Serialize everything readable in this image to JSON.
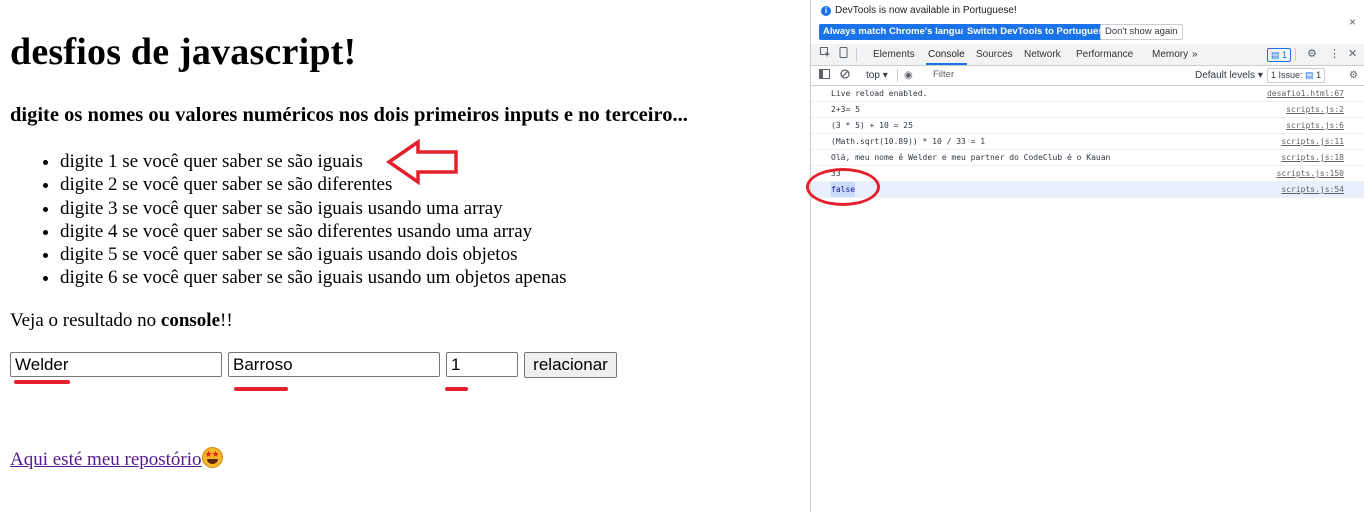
{
  "page": {
    "title": "desfios de javascript!",
    "subtitle": "digite os nomes ou valores numéricos nos dois primeiros inputs e no terceiro...",
    "options": [
      "digite 1 se você quer saber se são iguais",
      "digite 2 se você quer saber se são diferentes",
      "digite 3 se você quer saber se são iguais usando uma array",
      "digite 4 se você quer saber se são diferentes usando uma array",
      "digite 5 se você quer saber se são iguais usando dois objetos",
      "digite 6 se você quer saber se são iguais usando um objetos apenas"
    ],
    "result_prefix": "Veja o resultado no ",
    "result_bold": "console",
    "result_suffix": "!!",
    "input1_value": "Welder",
    "input2_value": "Barroso",
    "input3_value": "1",
    "button_label": "relacionar",
    "repo_link_text": "Aqui esté meu repostório",
    "annotation_color": "#e3202c"
  },
  "devtools": {
    "info_text": "DevTools is now available in Portuguese!",
    "info_buttons": {
      "match": "Always match Chrome's language",
      "switch": "Switch DevTools to Portuguese",
      "dismiss": "Don't show again"
    },
    "close_glyph": "×",
    "tabs": [
      "Elements",
      "Console",
      "Sources",
      "Network",
      "Performance",
      "Memory"
    ],
    "active_tab": "Console",
    "more_tabs_glyph": "»",
    "messages_badge": "1",
    "context": "top",
    "filter_placeholder": "Filter",
    "levels_label": "Default levels",
    "issues_label": "1 Issue:",
    "issues_count": "1",
    "console_rows": [
      {
        "msg": "Live reload enabled.",
        "src": "desafio1.html:67"
      },
      {
        "msg": "2+3= 5",
        "src": "scripts.js:2"
      },
      {
        "msg": "(3 * 5) + 10 = 25",
        "src": "scripts.js:6"
      },
      {
        "msg": "(Math.sqrt(10.89)) * 10 / 33 = 1",
        "src": "scripts.js:11"
      },
      {
        "msg": "Olá, meu nome é Welder e meu partner do CodeClub é o Kauan",
        "src": "scripts.js:18"
      },
      {
        "msg": "33",
        "src": "scripts.js:150"
      },
      {
        "msg": "false",
        "src": "scripts.js:54"
      }
    ]
  }
}
